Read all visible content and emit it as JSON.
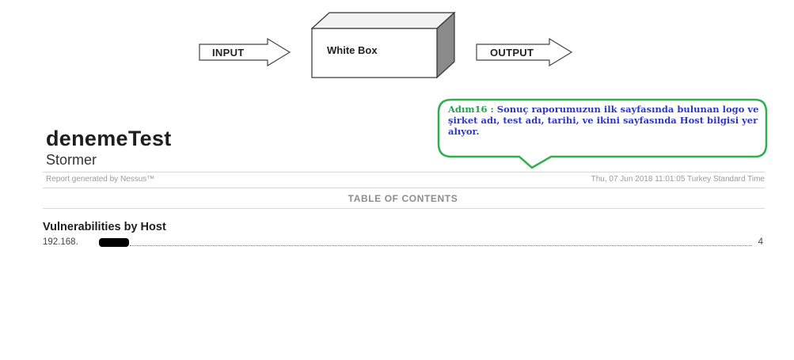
{
  "diagram": {
    "input_label": "INPUT",
    "box_label": "White Box",
    "output_label": "OUTPUT"
  },
  "callout": {
    "step": "Adım16 :",
    "text": "Sonuç raporumuzun ilk sayfasında bulunan logo ve şirket adı, test adı, tarihi, ve ikini sayfasında  Host bilgisi yer alıyor."
  },
  "report": {
    "title": "denemeTest",
    "subtitle": "Stormer",
    "generated_by": "Report generated by Nessus™",
    "timestamp": "Thu, 07 Jun 2018 11:01:05 Turkey Standard Time",
    "toc_heading": "TABLE OF CONTENTS",
    "section_heading": "Vulnerabilities by Host",
    "entries": [
      {
        "host": "192.168.",
        "page": "4"
      }
    ]
  },
  "colors": {
    "callout_border": "#2fb04c",
    "callout_step": "#1fa34a",
    "callout_text": "#2e36c8"
  }
}
